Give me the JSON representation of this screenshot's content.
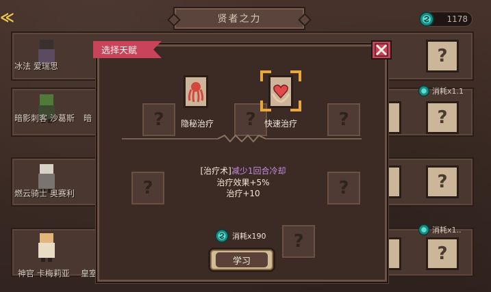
{
  "header": {
    "title": "贤者之力",
    "back_symbol": "≪",
    "currency_value": "1178"
  },
  "background_rows": [
    {
      "name": "冰法 爱瑞思",
      "cost": ""
    },
    {
      "name": "暗影刺客 沙葛斯",
      "name2": "暗",
      "cost": "消耗x1.1"
    },
    {
      "name": "燃云骑士 奥赛利",
      "cost": ""
    },
    {
      "name": "神官 卡梅莉亚",
      "name2": "皇室",
      "cost": "消耗x1.."
    }
  ],
  "modal": {
    "tab_label": "选择天赋",
    "talents": [
      {
        "label": "隐秘治疗",
        "icon": "squid-icon",
        "selected": false
      },
      {
        "label": "快速治疗",
        "icon": "heart-hands-icon",
        "selected": true
      }
    ],
    "description": {
      "bracket": "[治疗术]",
      "effect": "减少1回合冷却",
      "line2": "治疗效果+5%",
      "line3": "治疗+10"
    },
    "cost_label": "消耗x190",
    "learn_button": "学习"
  },
  "colors": {
    "accent_red": "#c9435a",
    "highlight_gold": "#e8a93a",
    "purple_text": "#c58ee2",
    "gem_teal": "#2fb3a6"
  }
}
